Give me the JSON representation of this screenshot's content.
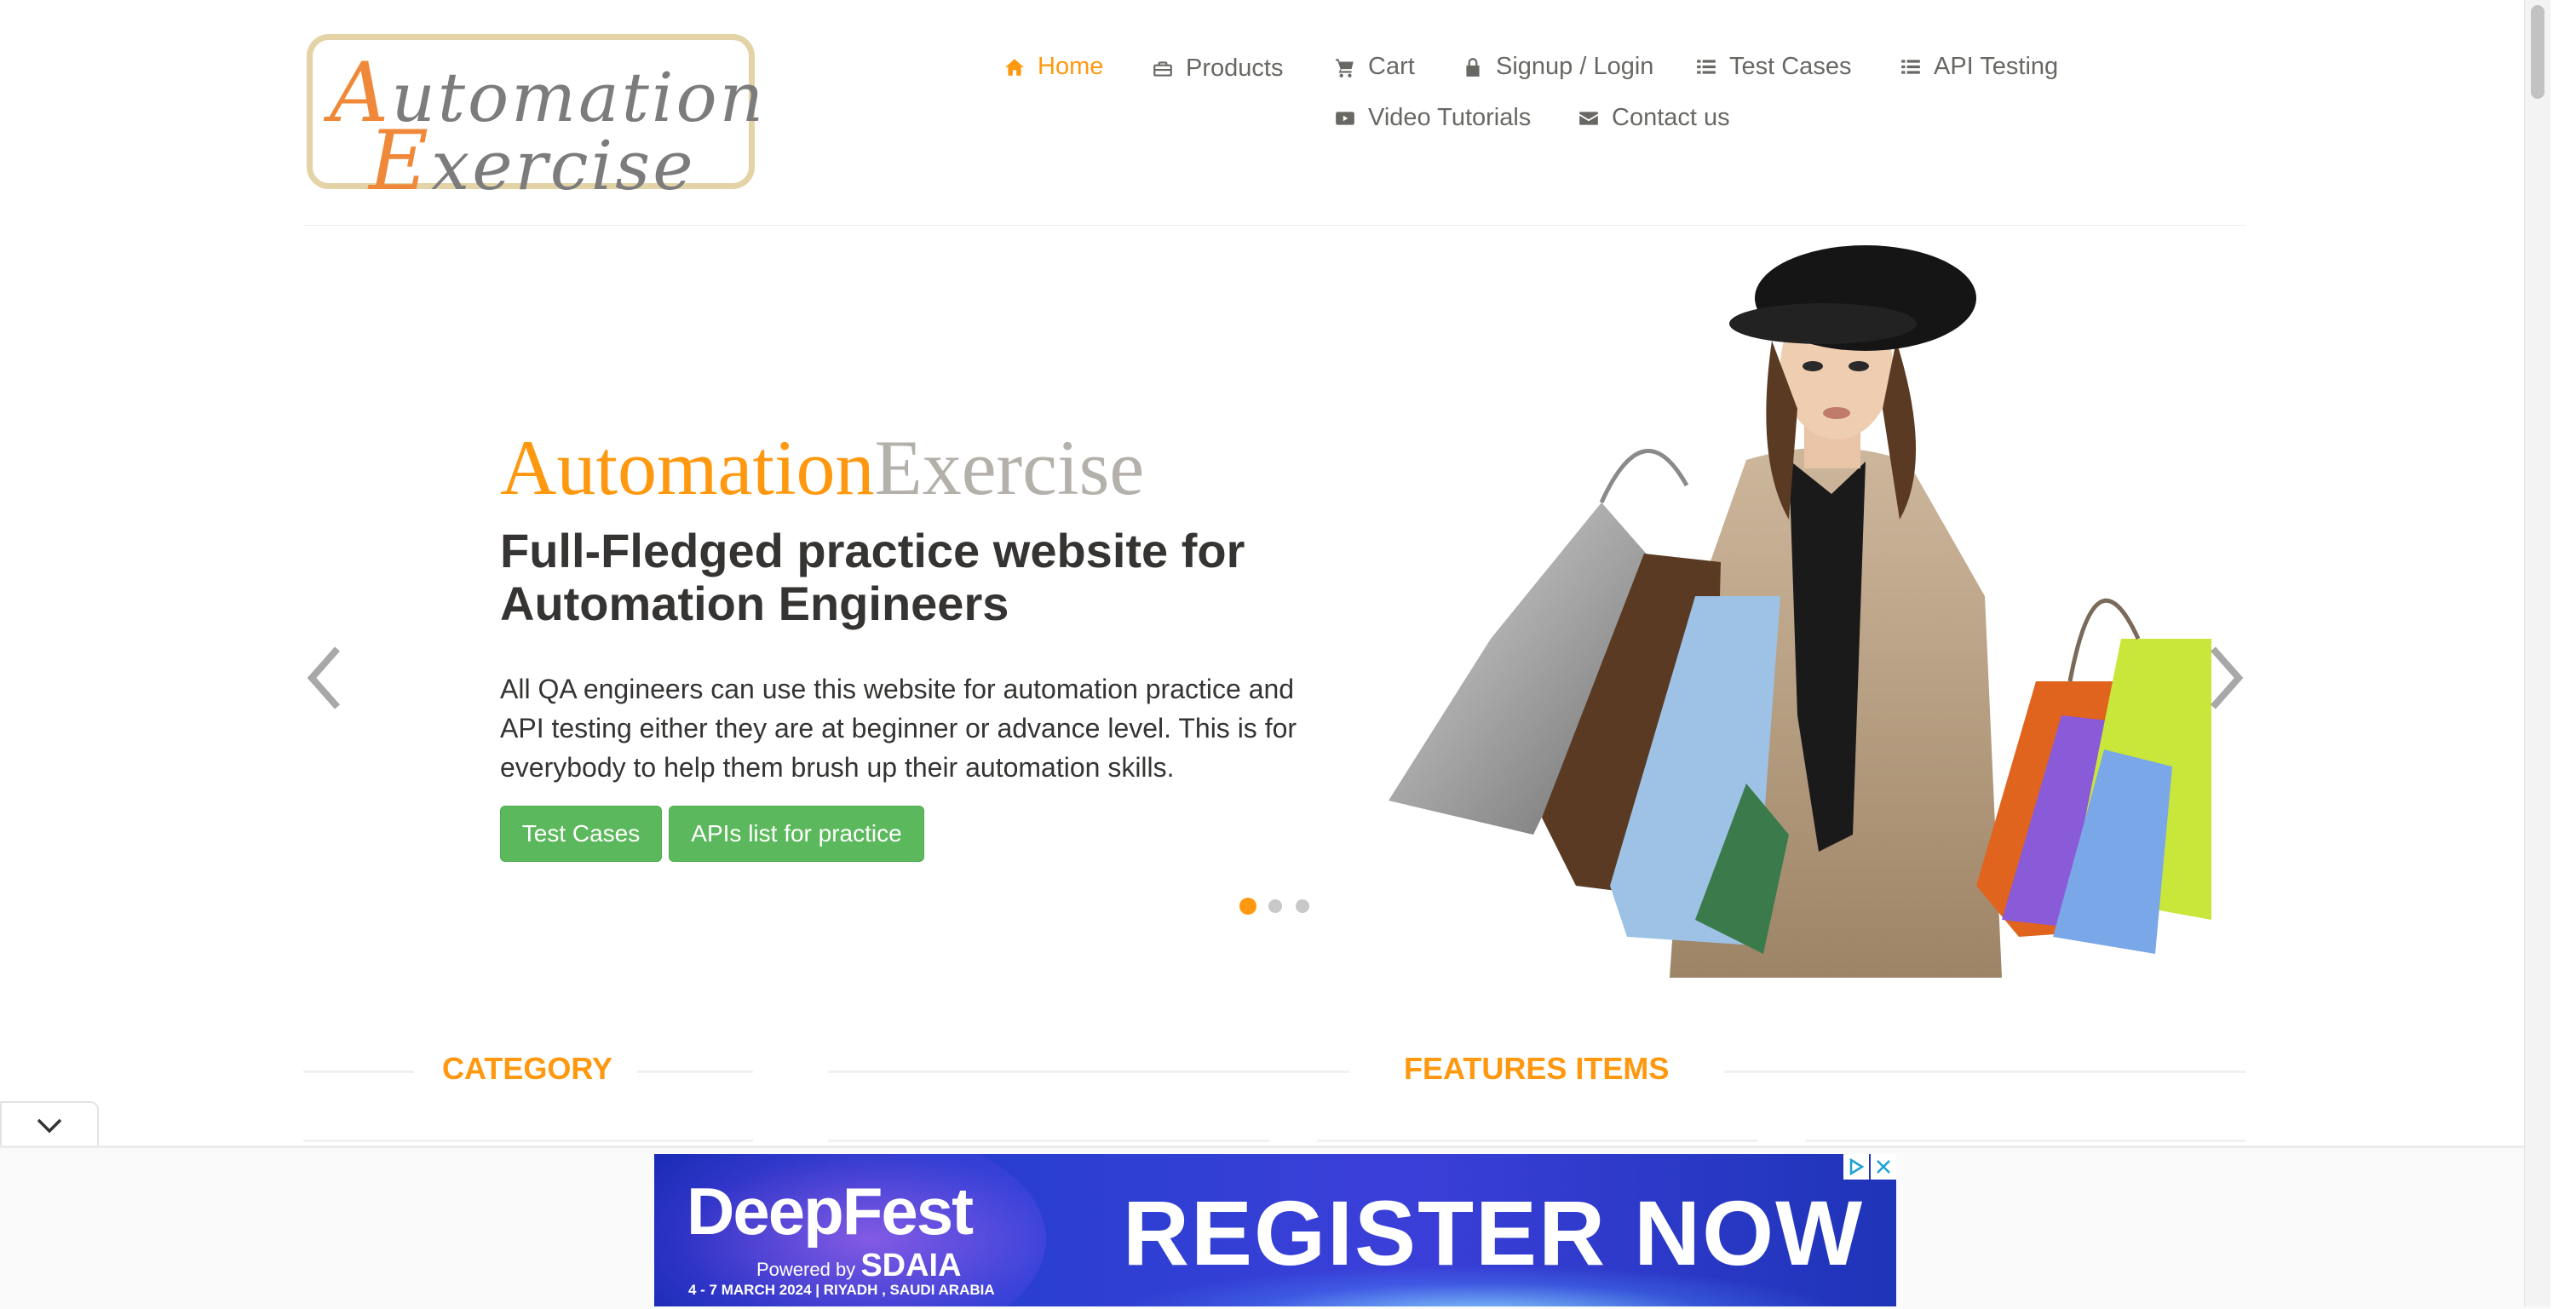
{
  "header": {
    "logo": {
      "line1": "Automation",
      "line2": "Exercise"
    },
    "nav": [
      {
        "label": "Home",
        "icon": "home-icon",
        "active": true
      },
      {
        "label": "Products",
        "icon": "briefcase-icon"
      },
      {
        "label": "Cart",
        "icon": "cart-icon"
      },
      {
        "label": "Signup / Login",
        "icon": "lock-icon"
      },
      {
        "label": "Test Cases",
        "icon": "list-icon"
      },
      {
        "label": "API Testing",
        "icon": "list-icon"
      },
      {
        "label": "Video Tutorials",
        "icon": "youtube-play-icon"
      },
      {
        "label": "Contact us",
        "icon": "envelope-icon"
      }
    ]
  },
  "slider": {
    "brand_part1": "Automation",
    "brand_part2": "Exercise",
    "headline": "Full-Fledged practice website for Automation Engineers",
    "description": "All QA engineers can use this website for automation practice and API testing either they are at beginner or advance level. This is for everybody to help them brush up their automation skills.",
    "buttons": {
      "test_cases": "Test Cases",
      "apis_list": "APIs list for practice"
    },
    "indicators": {
      "count": 3,
      "active_index": 0
    }
  },
  "sections": {
    "category_title": "CATEGORY",
    "features_title": "FEATURES ITEMS"
  },
  "ad": {
    "brand": "DeepFest",
    "powered_by": "Powered by",
    "sponsor": "SDAIA",
    "date_line": "4 - 7 MARCH 2024 | RIYADH , SAUDI ARABIA",
    "cta": "REGISTER NOW"
  },
  "colors": {
    "accent": "#fe980f",
    "button_green": "#5cb85c",
    "heading_dark": "#363432",
    "nav_text": "#696763"
  }
}
